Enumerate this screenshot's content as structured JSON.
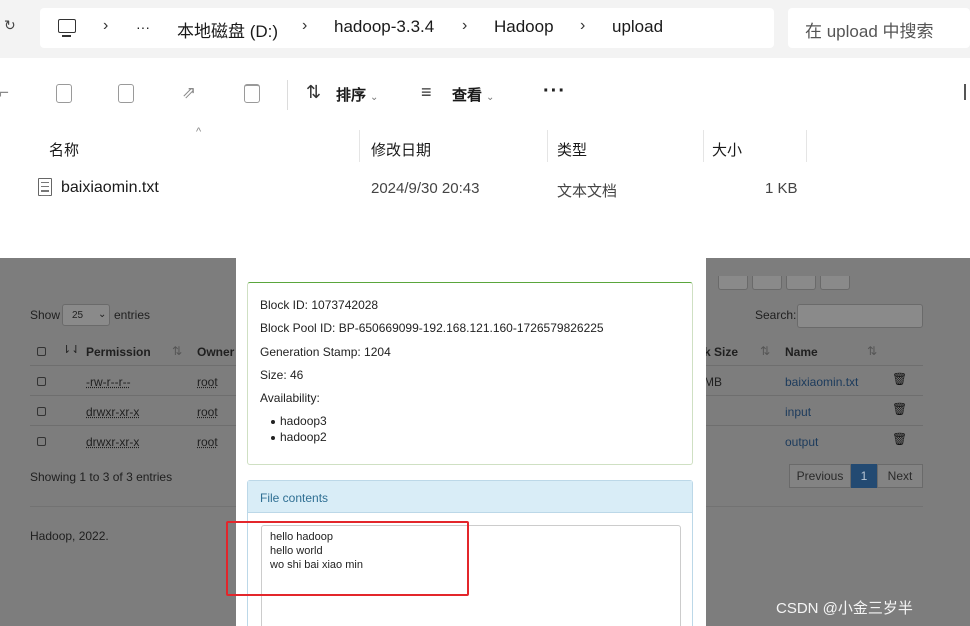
{
  "explorer": {
    "breadcrumbs": [
      "本地磁盘 (D:)",
      "hadoop-3.3.4",
      "Hadoop",
      "upload"
    ],
    "breadcrumb_overflow": "···",
    "search_placeholder": "在 upload 中搜索",
    "toolbar": {
      "sort_label": "排序",
      "view_label": "查看",
      "more_label": "···"
    },
    "columns": [
      "名称",
      "修改日期",
      "类型",
      "大小"
    ],
    "files": [
      {
        "name": "baixiaomin.txt",
        "modified": "2024/9/30 20:43",
        "type": "文本文档",
        "size": "1 KB"
      }
    ]
  },
  "hdfs": {
    "show_label": "Show",
    "entries_value": "25",
    "entries_label": "entries",
    "search_label": "Search:",
    "table_headers": {
      "permission": "Permission",
      "owner": "Owner",
      "block_size": "k Size",
      "name": "Name"
    },
    "rows": [
      {
        "permission": "-rw-r--r--",
        "owner": "root",
        "size": "MB",
        "name": "baixiaomin.txt"
      },
      {
        "permission": "drwxr-xr-x",
        "owner": "root",
        "size": "",
        "name": "input"
      },
      {
        "permission": "drwxr-xr-x",
        "owner": "root",
        "size": "",
        "name": "output"
      }
    ],
    "showing_text": "Showing 1 to 3 of 3 entries",
    "pager": {
      "previous": "Previous",
      "current": "1",
      "next": "Next"
    },
    "footer": "Hadoop, 2022."
  },
  "block_info": {
    "block_id": "Block ID: 1073742028",
    "block_pool_id": "Block Pool ID: BP-650669099-192.168.121.160-1726579826225",
    "generation_stamp": "Generation Stamp: 1204",
    "size": "Size: 46",
    "availability_label": "Availability:",
    "hosts": [
      "hadoop3",
      "hadoop2"
    ]
  },
  "file_contents": {
    "title": "File contents",
    "lines": [
      "hello hadoop",
      "hello world",
      "wo shi bai xiao min"
    ]
  },
  "watermark": "CSDN @小金三岁半",
  "colors": {
    "highlight_box": "#e3262b",
    "panel_header": "#d9edf7",
    "link": "#1b3a5c",
    "pager_active": "#234a72"
  }
}
